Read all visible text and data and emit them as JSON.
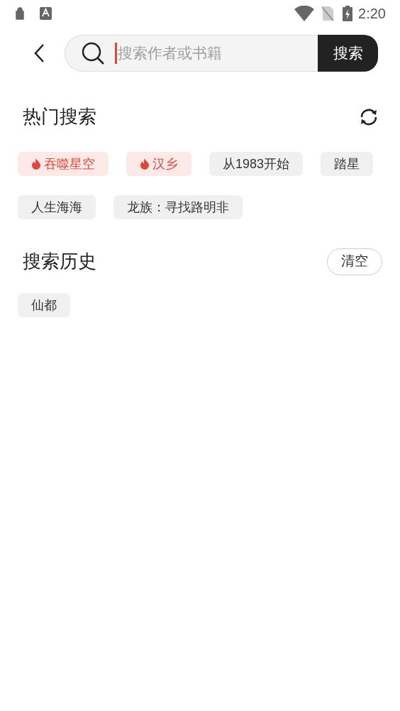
{
  "status_bar": {
    "time": "2:20"
  },
  "search": {
    "placeholder": "搜索作者或书籍",
    "button": "搜索"
  },
  "hot": {
    "title": "热门搜索",
    "tags": [
      {
        "label": "吞噬星空",
        "kind": "hot"
      },
      {
        "label": "汉乡",
        "kind": "hot"
      },
      {
        "label": "从1983开始",
        "kind": "normal"
      },
      {
        "label": "踏星",
        "kind": "normal"
      },
      {
        "label": "人生海海",
        "kind": "normal"
      },
      {
        "label": "龙族：寻找路明非",
        "kind": "normal"
      }
    ]
  },
  "history": {
    "title": "搜索历史",
    "clear_button": "清空",
    "items": [
      "仙都"
    ]
  }
}
